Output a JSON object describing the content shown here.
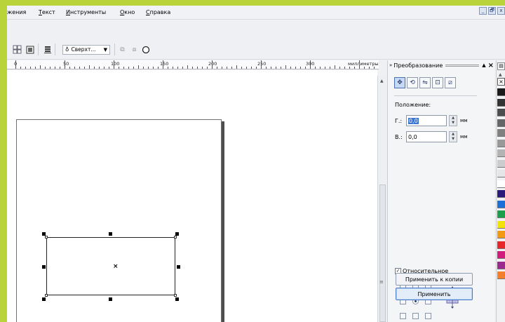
{
  "menu": {
    "items": [
      {
        "label": "жения",
        "underline": ""
      },
      {
        "label": "Текст",
        "underline": "Т"
      },
      {
        "label": "Инструменты",
        "underline": "И"
      },
      {
        "label": "Окно",
        "underline": "О"
      },
      {
        "label": "Справка",
        "underline": "С"
      }
    ],
    "window_buttons": [
      "_",
      "🗗",
      "x"
    ]
  },
  "toolbar": {
    "order_combo_value": "Сверхт...",
    "icons": [
      "spinner-arrows-icon",
      "align-icon",
      "layer-icon",
      "order-combo",
      "weld-icon",
      "trim-icon",
      "circle-icon"
    ]
  },
  "ruler": {
    "labels": [
      "0",
      "50",
      "100",
      "150",
      "200",
      "250",
      "300"
    ],
    "unit_label": "миллиметры"
  },
  "docker": {
    "title": "Преобразование",
    "position_label": "Положение:",
    "h_label": "Г.:",
    "h_value": "0,0",
    "v_label": "В.:",
    "v_value": "0,0",
    "unit": "мм",
    "relative_label": "Относительное",
    "relative_checked": true,
    "apply_copy_label": "Применить к копии",
    "apply_label": "Применить"
  },
  "palette": {
    "colors": [
      "#1a1a1a",
      "#333333",
      "#4d4d4d",
      "#666666",
      "#808080",
      "#999999",
      "#b3b3b3",
      "#cccccc",
      "#e6e6e6",
      "#ffffff",
      "#2a1a7a",
      "#1c6fd6",
      "#1aa04a",
      "#f2e20c",
      "#f39a14",
      "#e6262b",
      "#d11c7b",
      "#9b2a8f",
      "#f47e2a"
    ]
  }
}
